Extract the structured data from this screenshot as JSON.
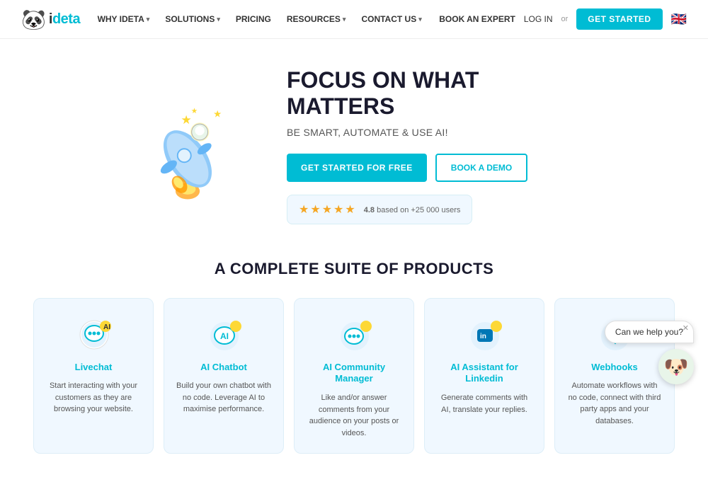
{
  "nav": {
    "logo_panda": "🐼",
    "logo_text_pre": "i",
    "logo_text_accent": "deta",
    "links": [
      {
        "label": "WHY IDETA",
        "has_chevron": true
      },
      {
        "label": "SOLUTIONS",
        "has_chevron": true
      },
      {
        "label": "PRICING",
        "has_chevron": false
      },
      {
        "label": "RESOURCES",
        "has_chevron": true
      },
      {
        "label": "CONTACT US",
        "has_chevron": true
      }
    ],
    "book_expert": "BOOK AN EXPERT",
    "login": "LOG IN",
    "or": "or",
    "get_started": "GET STARTED",
    "flag": "🇬🇧"
  },
  "hero": {
    "title": "FOCUS ON WHAT MATTERS",
    "subtitle": "BE SMART, AUTOMATE & USE AI!",
    "btn_primary": "GET STARTED FOR FREE",
    "btn_secondary": "BOOK A DEMO",
    "stars": "★★★★★",
    "rating_number": "4.8",
    "rating_text": "based on +25 000 users"
  },
  "products": {
    "section_title": "A COMPLETE SUITE OF PRODUCTS",
    "cards": [
      {
        "name": "Livechat",
        "desc": "Start interacting with your customers as they are browsing your website.",
        "icon_type": "livechat"
      },
      {
        "name": "AI Chatbot",
        "desc": "Build your own chatbot with no code. Leverage AI to maximise performance.",
        "icon_type": "chatbot"
      },
      {
        "name": "AI Community Manager",
        "desc": "Like and/or answer comments from your audience on your posts or videos.",
        "icon_type": "community"
      },
      {
        "name": "AI Assistant for Linkedin",
        "desc": "Generate comments with AI, translate your replies.",
        "icon_type": "linkedin"
      },
      {
        "name": "Webhooks",
        "desc": "Automate workflows with no code, connect with third party apps and your databases.",
        "icon_type": "webhooks"
      }
    ]
  },
  "chat_widget": {
    "bubble_text": "Can we help you?",
    "avatar_emoji": "🐶"
  }
}
